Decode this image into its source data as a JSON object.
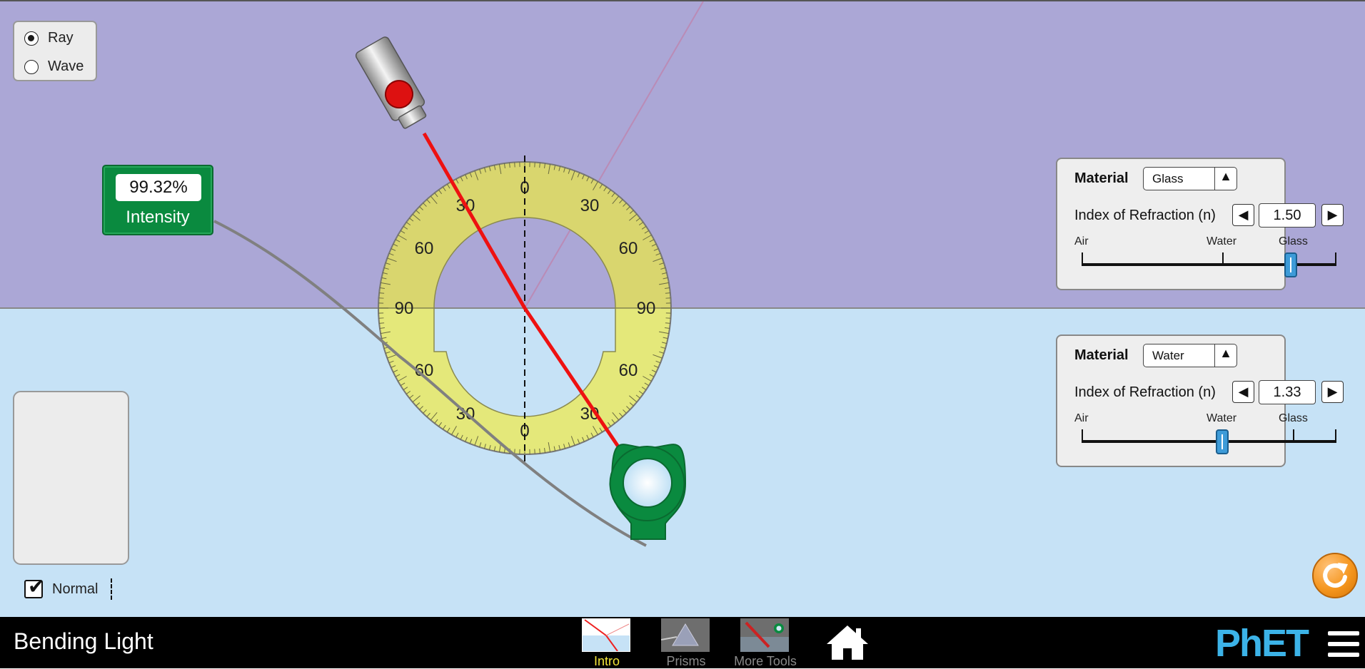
{
  "app": {
    "title": "Bending Light"
  },
  "mode_panel": {
    "options": [
      {
        "label": "Ray",
        "selected": true
      },
      {
        "label": "Wave",
        "selected": false
      }
    ]
  },
  "intensity_meter": {
    "value": "99.32%",
    "label": "Intensity"
  },
  "normal_toggle": {
    "label": "Normal",
    "checked": true
  },
  "protractor": {
    "upper_labels": [
      "0",
      "30",
      "30",
      "60",
      "60",
      "90",
      "90"
    ],
    "lower_labels": [
      "60",
      "60",
      "30",
      "30",
      "0"
    ]
  },
  "top_material": {
    "label": "Material",
    "selected": "Glass",
    "ior_label": "Index of Refraction (n)",
    "ior_value": "1.50",
    "slider_level": 0.82,
    "slider_ticks": [
      "Air",
      "Water",
      "Glass"
    ]
  },
  "bottom_material": {
    "label": "Material",
    "selected": "Water",
    "ior_label": "Index of Refraction (n)",
    "ior_value": "1.33",
    "slider_level": 0.55,
    "slider_ticks": [
      "Air",
      "Water",
      "Glass"
    ]
  },
  "nav": {
    "tabs": [
      {
        "label": "Intro",
        "active": true
      },
      {
        "label": "Prisms",
        "active": false
      },
      {
        "label": "More Tools",
        "active": false
      }
    ]
  },
  "brand": {
    "logo_text": "PhET"
  },
  "colors": {
    "top_medium": "#aba7d6",
    "bottom_medium": "#c6e2f6",
    "laser_beam": "#ee1111",
    "sensor_green": "#0a8a3f",
    "protractor": "#e0e07a",
    "nav_active": "#f5e83a",
    "reset_orange": "#f5961e",
    "phet_blue": "#3cb3e8"
  }
}
